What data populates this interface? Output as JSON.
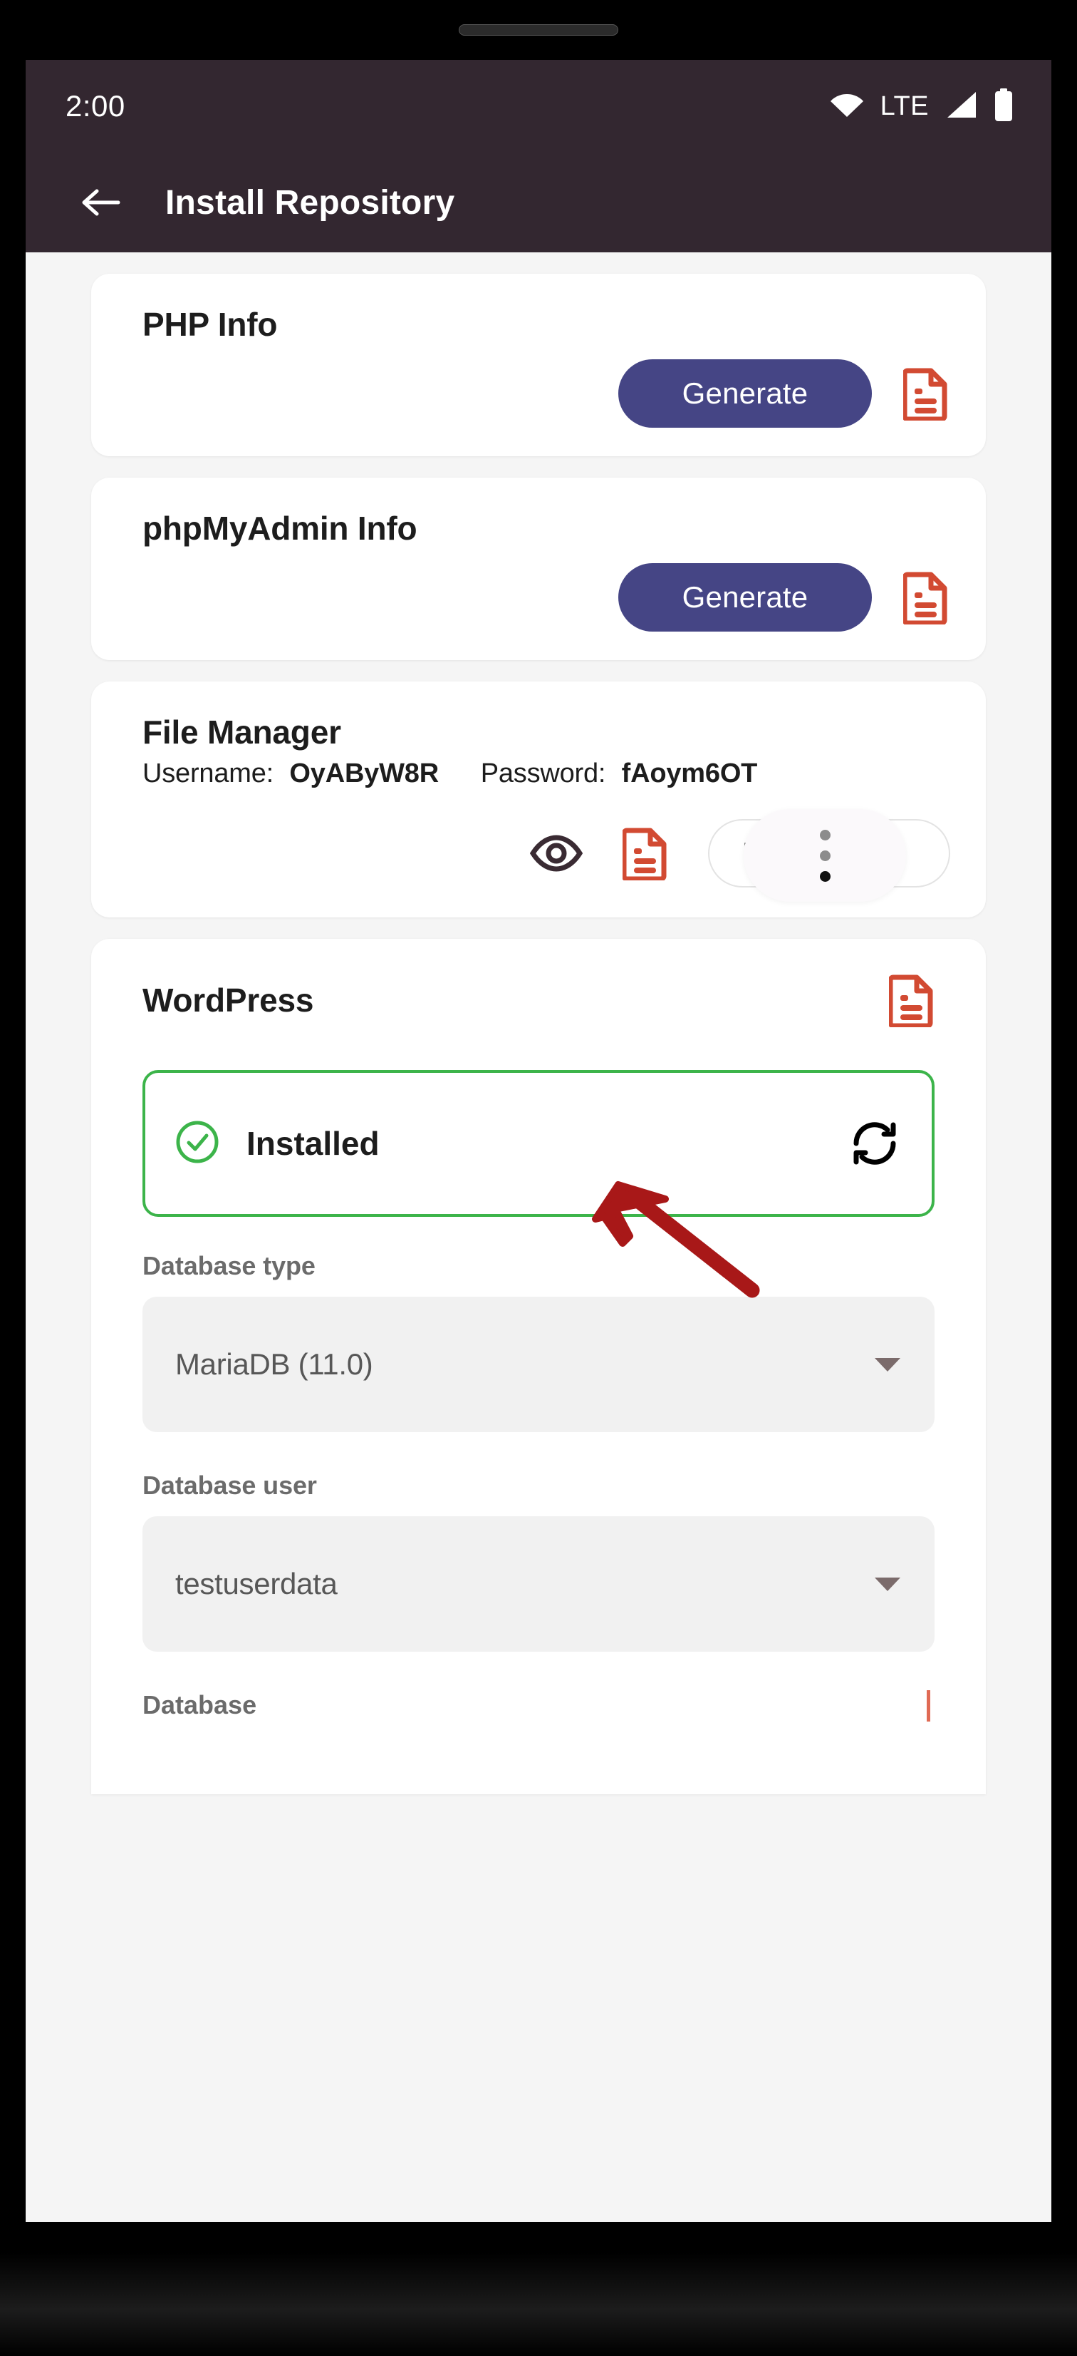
{
  "status_bar": {
    "clock": "2:00",
    "network_label": "LTE",
    "icons": [
      "wifi-icon",
      "signal-icon",
      "battery-icon"
    ]
  },
  "app_bar": {
    "back_icon": "arrow-left-icon",
    "title": "Install Repository"
  },
  "colors": {
    "app_bar_bg": "#332730",
    "page_bg": "#f5f5f5",
    "card_bg": "#ffffff",
    "primary_button": "#454585",
    "doc_icon": "#d24a32",
    "status_success": "#3cb44a",
    "annotation_arrow": "#a81818",
    "field_bg": "#f1f1f1"
  },
  "cards": {
    "php_info": {
      "title": "PHP Info",
      "generate_label": "Generate",
      "doc_icon": "document-icon"
    },
    "phpmyadmin_info": {
      "title": "phpMyAdmin Info",
      "generate_label": "Generate",
      "doc_icon": "document-icon"
    },
    "file_manager": {
      "title": "File Manager",
      "username_label": "Username:",
      "username_value": "OyAByW8R",
      "password_label": "Password:",
      "password_value": "fAoym6OT",
      "eye_icon": "eye-icon",
      "doc_icon": "document-icon",
      "more_label": "More",
      "more_menu_icon": "dots-vertical-icon"
    },
    "wordpress": {
      "title": "WordPress",
      "doc_icon": "document-icon",
      "status_label": "Installed",
      "status_check_icon": "check-circle-icon",
      "refresh_icon": "refresh-icon",
      "fields": [
        {
          "label": "Database type",
          "value": "MariaDB (11.0)",
          "caret_icon": "chevron-down-icon"
        },
        {
          "label": "Database user",
          "value": "testuserdata",
          "caret_icon": "chevron-down-icon"
        }
      ],
      "cutoff_label": "Database"
    }
  },
  "annotation": {
    "type": "arrow",
    "description": "red arrow pointing to File Manager document icon"
  },
  "nav": {
    "home_indicator": "home-indicator"
  }
}
